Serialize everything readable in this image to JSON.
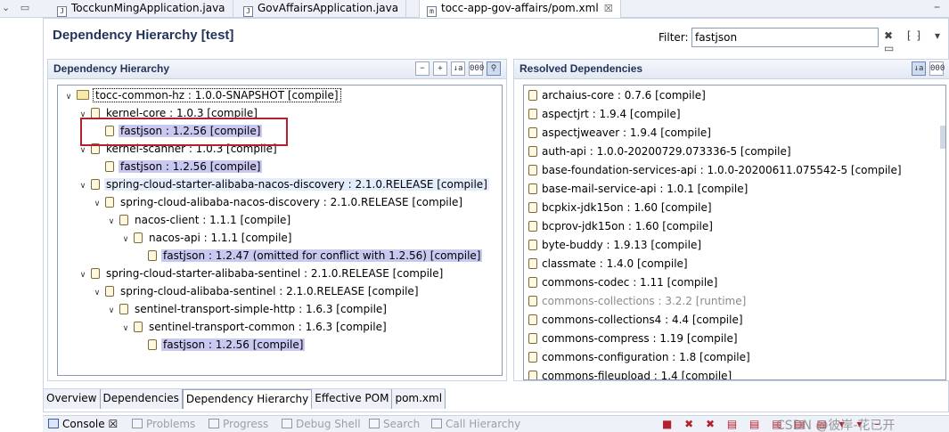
{
  "editor_tabs": [
    {
      "label": "TocckunMingApplication.java",
      "icon": "java-file-icon",
      "active": false
    },
    {
      "label": "GovAffairsApplication.java",
      "icon": "java-file-icon",
      "active": false
    },
    {
      "label": "tocc-app-gov-affairs/pom.xml",
      "icon": "maven-pom-icon",
      "active": true,
      "close": "☒"
    }
  ],
  "editor": {
    "title": "Dependency Hierarchy [test]",
    "filter_label": "Filter:",
    "filter_value": "fastjson"
  },
  "hierarchy": {
    "header": "Dependency Hierarchy",
    "nodes": [
      {
        "label": "tocc-common-hz : 1.0.0-SNAPSHOT [compile]",
        "depth": 0,
        "twisty": "expanded",
        "icon": "folder-icon"
      },
      {
        "label": "kernel-core : 1.0.3 [compile]",
        "depth": 1,
        "twisty": "expanded",
        "icon": "jar-icon"
      },
      {
        "label": "fastjson : 1.2.56 [compile]",
        "depth": 2,
        "twisty": "none",
        "icon": "jar-icon",
        "highlight": true
      },
      {
        "label": "kernel-scanner : 1.0.3 [compile]",
        "depth": 1,
        "twisty": "expanded",
        "icon": "jar-icon"
      },
      {
        "label": "fastjson : 1.2.56 [compile]",
        "depth": 2,
        "twisty": "none",
        "icon": "jar-icon",
        "highlight": true
      },
      {
        "label": "spring-cloud-starter-alibaba-nacos-discovery : 2.1.0.RELEASE [compile]",
        "depth": 1,
        "twisty": "expanded",
        "icon": "jar-icon",
        "light": true
      },
      {
        "label": "spring-cloud-alibaba-nacos-discovery : 2.1.0.RELEASE [compile]",
        "depth": 2,
        "twisty": "expanded",
        "icon": "jar-icon"
      },
      {
        "label": "nacos-client : 1.1.1 [compile]",
        "depth": 3,
        "twisty": "expanded",
        "icon": "jar-icon"
      },
      {
        "label": "nacos-api : 1.1.1 [compile]",
        "depth": 4,
        "twisty": "expanded",
        "icon": "jar-icon"
      },
      {
        "label": "fastjson : 1.2.47 (omitted for conflict with 1.2.56) [compile]",
        "depth": 5,
        "twisty": "none",
        "icon": "jar-icon",
        "highlight": true
      },
      {
        "label": "spring-cloud-starter-alibaba-sentinel : 2.1.0.RELEASE [compile]",
        "depth": 1,
        "twisty": "expanded",
        "icon": "jar-icon"
      },
      {
        "label": "spring-cloud-alibaba-sentinel : 2.1.0.RELEASE [compile]",
        "depth": 2,
        "twisty": "expanded",
        "icon": "jar-icon"
      },
      {
        "label": "sentinel-transport-simple-http : 1.6.3 [compile]",
        "depth": 3,
        "twisty": "expanded",
        "icon": "jar-icon"
      },
      {
        "label": "sentinel-transport-common : 1.6.3 [compile]",
        "depth": 4,
        "twisty": "expanded",
        "icon": "jar-icon"
      },
      {
        "label": "fastjson : 1.2.56 [compile]",
        "depth": 5,
        "twisty": "none",
        "icon": "jar-icon",
        "highlight": true
      }
    ]
  },
  "resolved": {
    "header": "Resolved Dependencies",
    "items": [
      {
        "label": "archaius-core : 0.7.6 [compile]"
      },
      {
        "label": "aspectjrt : 1.9.4 [compile]"
      },
      {
        "label": "aspectjweaver : 1.9.4 [compile]"
      },
      {
        "label": "auth-api : 1.0.0-20200729.073336-5 [compile]"
      },
      {
        "label": "base-foundation-services-api : 1.0.0-20200611.075542-5 [compile]"
      },
      {
        "label": "base-mail-service-api : 1.0.1 [compile]"
      },
      {
        "label": "bcpkix-jdk15on : 1.60 [compile]"
      },
      {
        "label": "bcprov-jdk15on : 1.60 [compile]"
      },
      {
        "label": "byte-buddy : 1.9.13 [compile]"
      },
      {
        "label": "classmate : 1.4.0 [compile]"
      },
      {
        "label": "commons-codec : 1.11 [compile]"
      },
      {
        "label": "commons-collections : 3.2.2 [runtime]",
        "gray": true
      },
      {
        "label": "commons-collections4 : 4.4 [compile]"
      },
      {
        "label": "commons-compress : 1.19 [compile]"
      },
      {
        "label": "commons-configuration : 1.8 [compile]"
      },
      {
        "label": "commons-fileupload : 1.4 [compile]"
      }
    ]
  },
  "bottom_tabs": [
    {
      "label": "Overview",
      "active": false
    },
    {
      "label": "Dependencies",
      "active": false
    },
    {
      "label": "Dependency Hierarchy",
      "active": true
    },
    {
      "label": "Effective POM",
      "active": false
    },
    {
      "label": "pom.xml",
      "active": false
    }
  ],
  "console_views": [
    {
      "label": "Console",
      "icon": "console-icon",
      "active": true,
      "close": "☒"
    },
    {
      "label": "Problems",
      "icon": "problems-icon",
      "active": false
    },
    {
      "label": "Progress",
      "icon": "progress-icon",
      "active": false
    },
    {
      "label": "Debug Shell",
      "icon": "debug-shell-icon",
      "active": false
    },
    {
      "label": "Search",
      "icon": "search-icon",
      "active": false
    },
    {
      "label": "Call Hierarchy",
      "icon": "call-hierarchy-icon",
      "active": false
    }
  ],
  "watermark": "CSDN @彼岸-花已开",
  "colors": {
    "highlight": "#c8c8f0",
    "header_text": "#23345a",
    "annotation_red": "#b5202e"
  }
}
